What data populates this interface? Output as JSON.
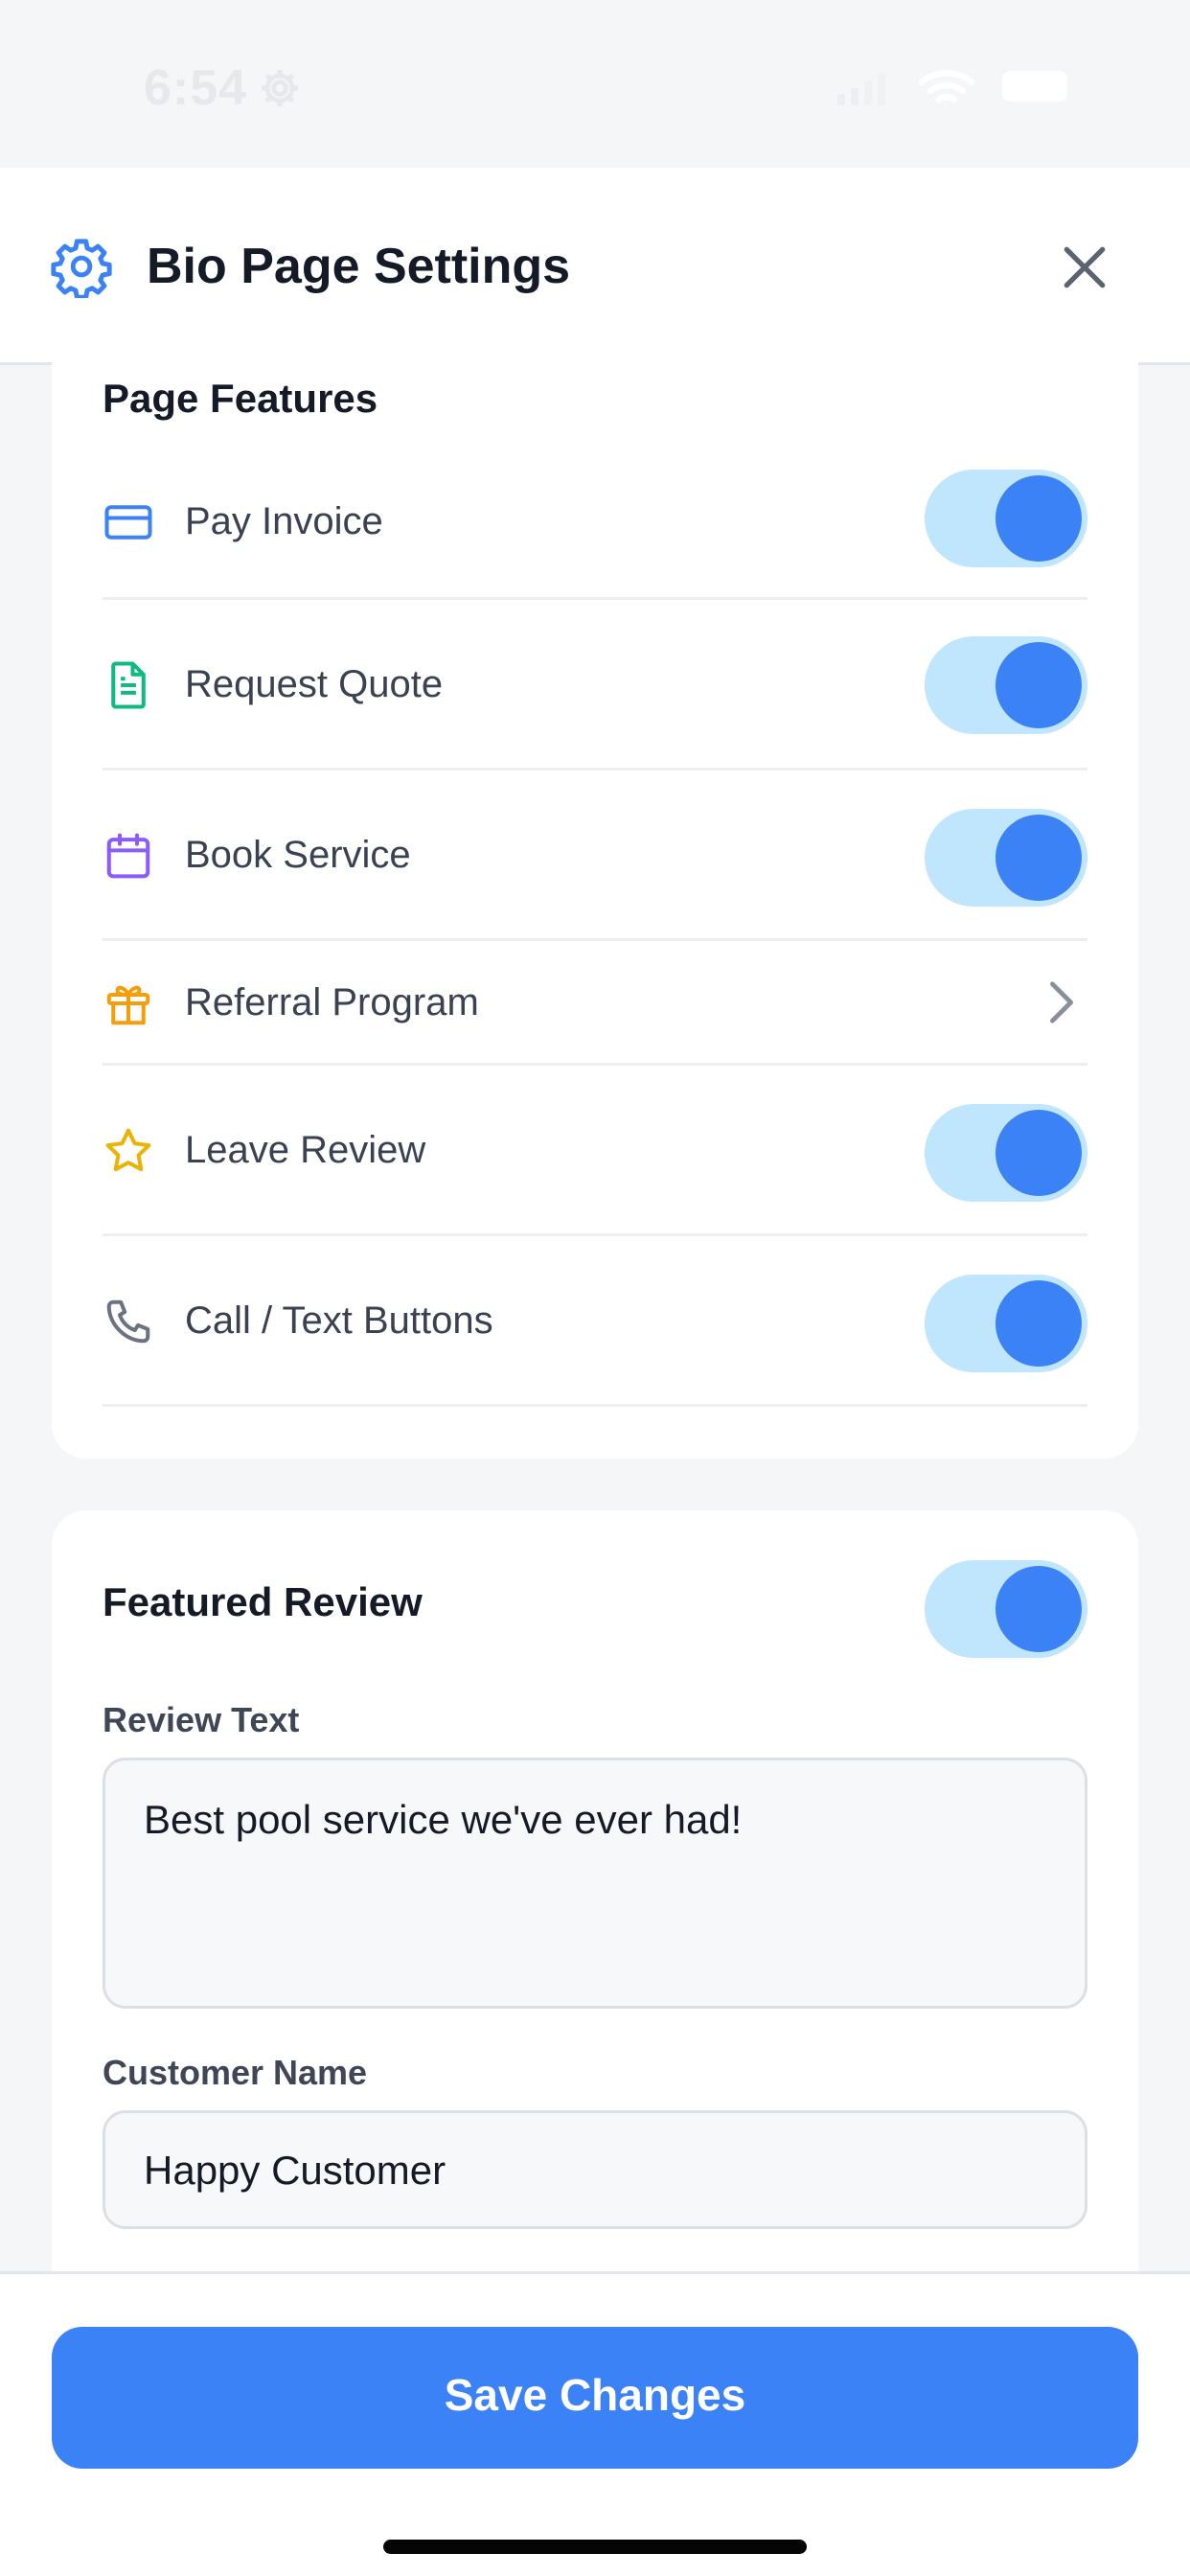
{
  "status_bar": {
    "time": "6:54",
    "icons": [
      "gear-icon",
      "signal-icon",
      "wifi-icon",
      "battery-icon"
    ]
  },
  "header": {
    "icon": "gear-icon",
    "title": "Bio Page Settings",
    "close_icon": "close-icon"
  },
  "page_features": {
    "title": "Page Features",
    "items": [
      {
        "label": "Pay Invoice",
        "icon": "credit-card-icon",
        "icon_color": "#3b82f6",
        "control": "toggle",
        "enabled": true
      },
      {
        "label": "Request Quote",
        "icon": "document-icon",
        "icon_color": "#10b981",
        "control": "toggle",
        "enabled": true
      },
      {
        "label": "Book Service",
        "icon": "calendar-icon",
        "icon_color": "#8b5cf6",
        "control": "toggle",
        "enabled": true
      },
      {
        "label": "Referral Program",
        "icon": "gift-icon",
        "icon_color": "#f59e0b",
        "control": "chevron",
        "enabled": null
      },
      {
        "label": "Leave Review",
        "icon": "star-icon",
        "icon_color": "#eab308",
        "control": "toggle",
        "enabled": true
      },
      {
        "label": "Call / Text Buttons",
        "icon": "phone-icon",
        "icon_color": "#6b7280",
        "control": "toggle",
        "enabled": true
      }
    ]
  },
  "featured_review": {
    "title": "Featured Review",
    "enabled": true,
    "review_text_label": "Review Text",
    "review_text_value": "Best pool service we've ever had!",
    "customer_name_label": "Customer Name",
    "customer_name_value": "Happy Customer"
  },
  "footer": {
    "save_label": "Save Changes"
  },
  "colors": {
    "accent": "#3b82f6",
    "toggle_track": "#bfe6fd",
    "background": "#f5f6f8"
  }
}
